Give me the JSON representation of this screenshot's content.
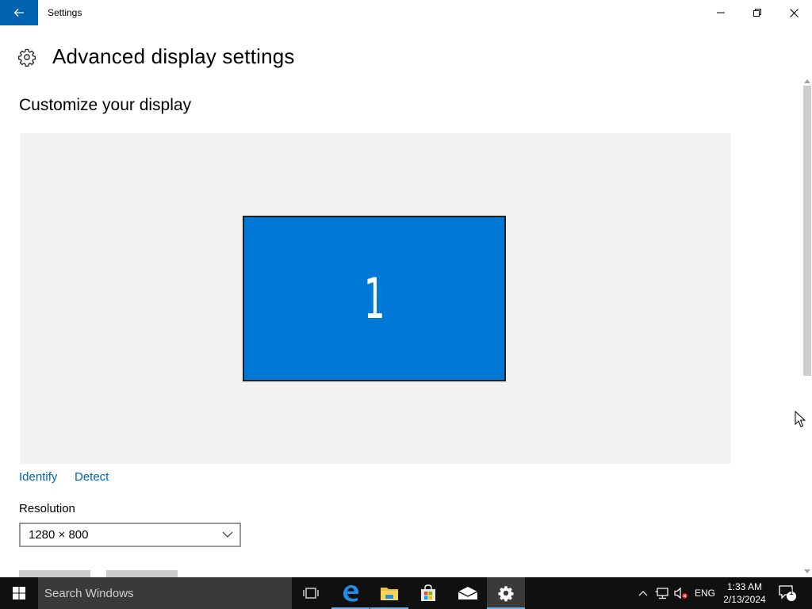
{
  "window": {
    "title": "Settings",
    "icons": {
      "back": "back-arrow-icon",
      "minimize": "minimize-icon",
      "restore": "restore-icon",
      "close": "close-icon"
    }
  },
  "page": {
    "title": "Advanced display settings",
    "icon": "gear-icon"
  },
  "content": {
    "section_heading": "Customize your display",
    "display_number": "1",
    "identify_link": "Identify",
    "detect_link": "Detect",
    "resolution_label": "Resolution",
    "resolution_value": "1280 × 800"
  },
  "taskbar": {
    "search_placeholder": "Search Windows",
    "apps": [
      "task-view-icon",
      "edge-icon",
      "file-explorer-icon",
      "store-icon",
      "mail-icon",
      "settings-icon"
    ],
    "language": "ENG",
    "time": "1:33 AM",
    "date": "2/13/2024",
    "notification_count": "1"
  },
  "colors": {
    "accent": "#0063b1",
    "display_tile": "#0078d7",
    "link": "#0063b1",
    "taskbar": "#101010"
  }
}
